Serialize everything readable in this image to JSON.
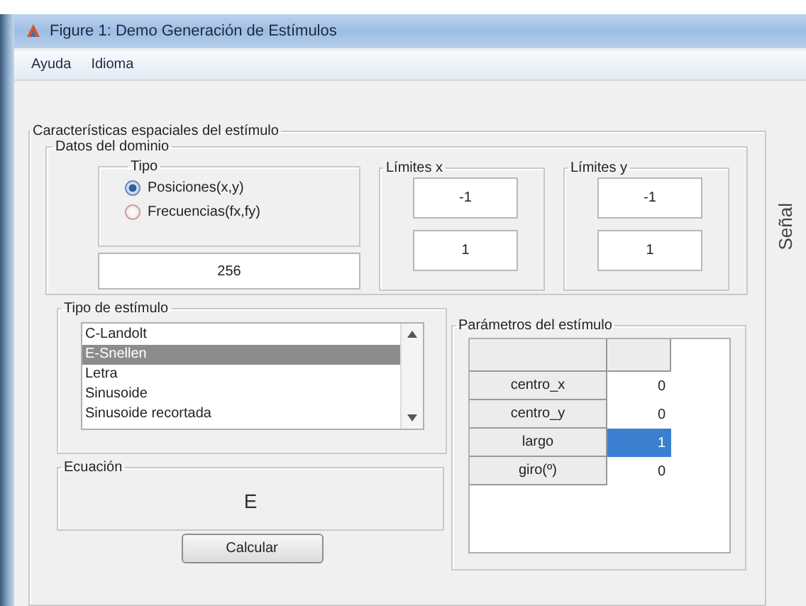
{
  "window": {
    "title": "Figure 1: Demo Generación de Estímulos"
  },
  "menu": [
    {
      "label": "Ayuda"
    },
    {
      "label": "Idioma"
    }
  ],
  "panel": {
    "title": "Características espaciales del estímulo"
  },
  "domain": {
    "title": "Datos del dominio",
    "tipo": {
      "title": "Tipo",
      "options": [
        {
          "label": "Posiciones(x,y)",
          "selected": true
        },
        {
          "label": "Frecuencias(fx,fy)",
          "selected": false
        }
      ]
    },
    "points": "256",
    "limits": [
      {
        "title": "Límites x",
        "values": [
          "-1",
          "1"
        ]
      },
      {
        "title": "Límites y",
        "values": [
          "-1",
          "1"
        ]
      }
    ]
  },
  "side_tab": "Señal",
  "stimulus_type": {
    "title": "Tipo de estímulo",
    "items": [
      {
        "label": "C-Landolt",
        "selected": false
      },
      {
        "label": "E-Snellen",
        "selected": true
      },
      {
        "label": "Letra",
        "selected": false
      },
      {
        "label": "Sinusoide",
        "selected": false
      },
      {
        "label": "Sinusoide recortada",
        "selected": false
      }
    ]
  },
  "equation": {
    "title": "Ecuación",
    "value": "E"
  },
  "button": "Calcular",
  "parameters": {
    "title": "Parámetros del estímulo",
    "rows": [
      {
        "name": "centro_x",
        "value": "0",
        "selected": false
      },
      {
        "name": "centro_y",
        "value": "0",
        "selected": false
      },
      {
        "name": "largo",
        "value": "1",
        "selected": true
      },
      {
        "name": "giro(º)",
        "value": "0",
        "selected": false
      }
    ]
  }
}
